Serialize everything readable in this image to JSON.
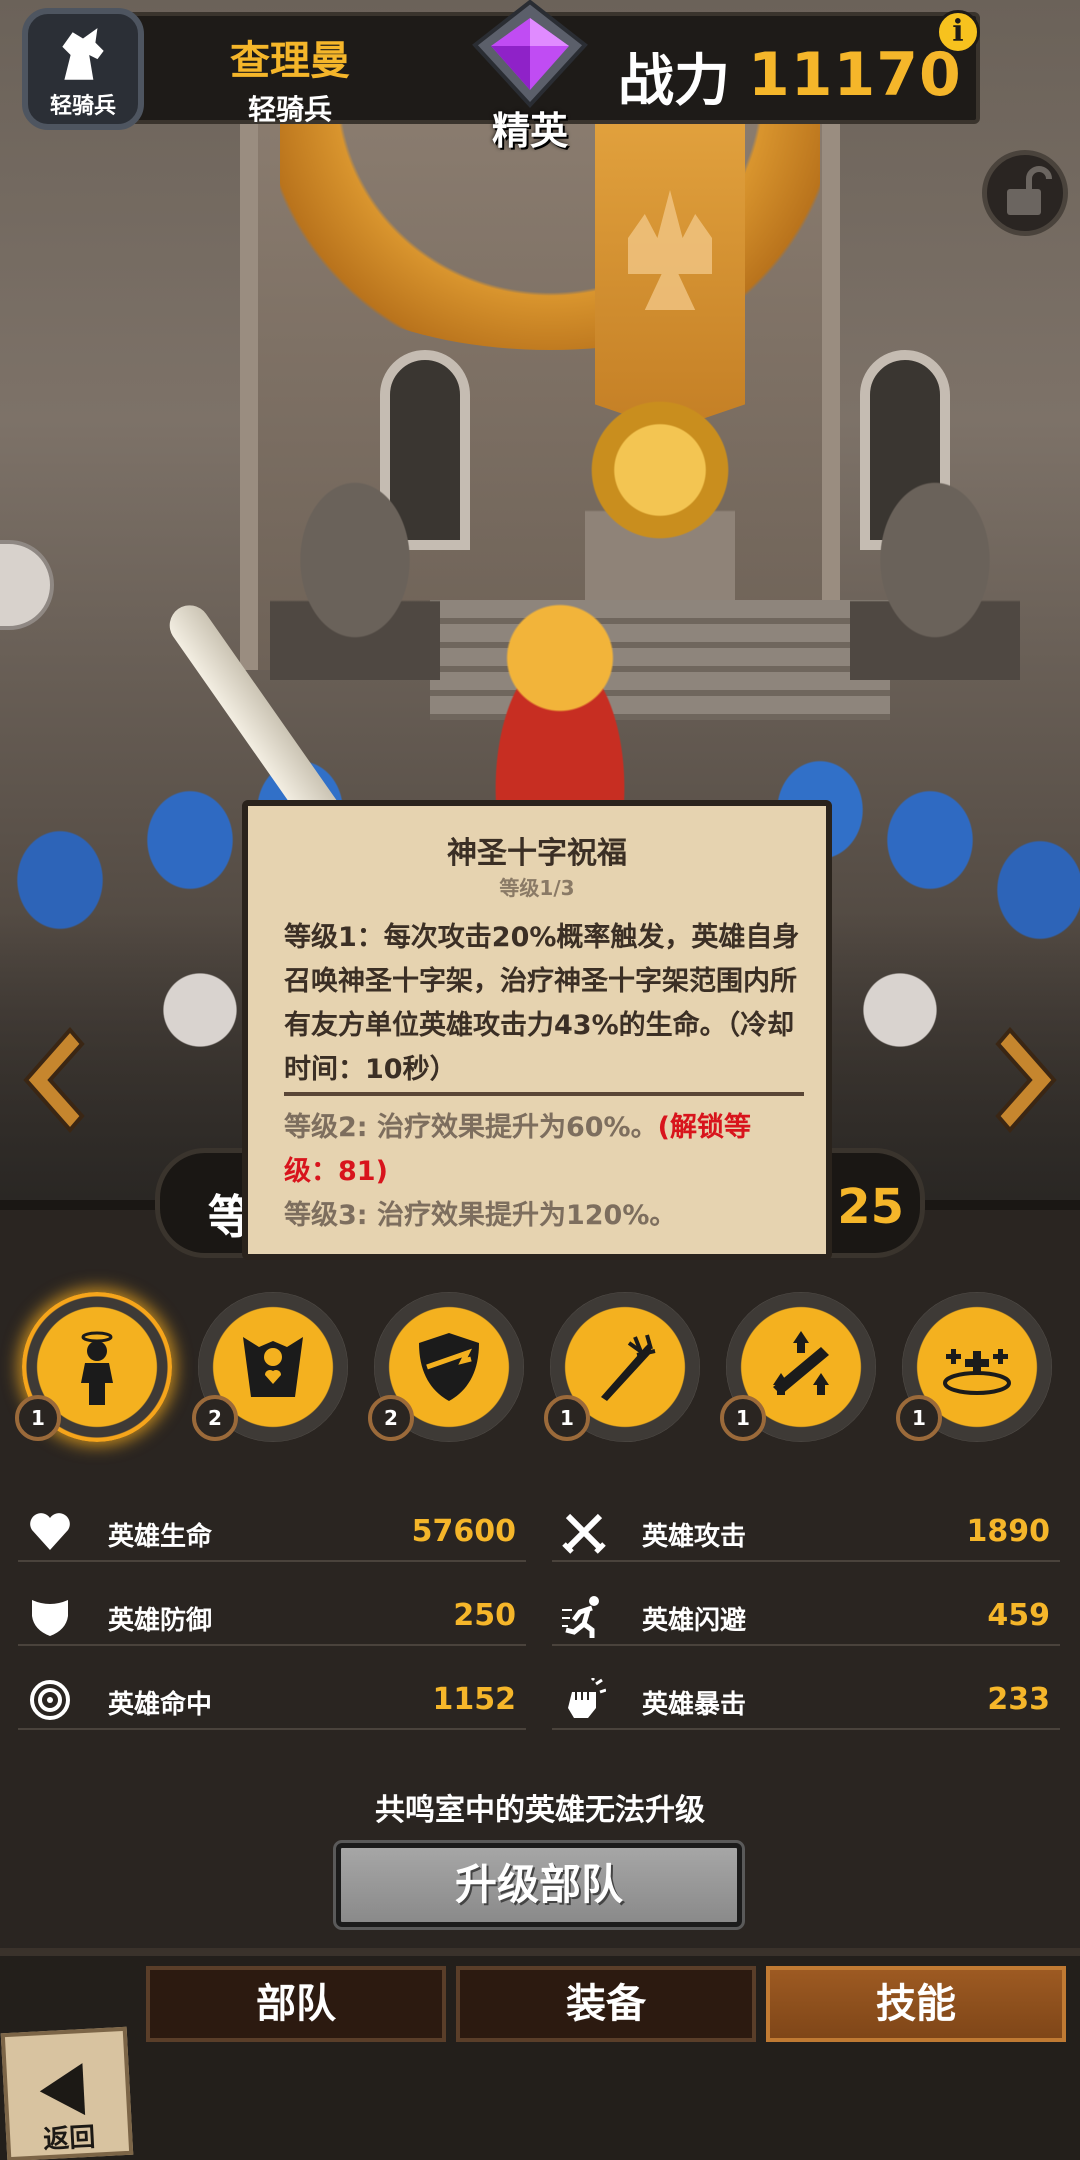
{
  "hud": {
    "class_badge_label": "轻骑兵",
    "hero_name": "查理曼",
    "hero_class": "轻骑兵",
    "rank_label": "精英",
    "power_label": "战力",
    "power_value": "11170",
    "info_icon": "i"
  },
  "level_strip": {
    "label_fragment": "等",
    "level_value": "25"
  },
  "tooltip": {
    "title": "神圣十字祝福",
    "level": "等级1/3",
    "current_effect": "等级1：每次攻击20%概率触发，英雄自身召唤神圣十字架，治疗神圣十字架范围内所有友方单位英雄攻击力43%的生命。（冷却时间：10秒）",
    "next_effect_2": "等级2: 治疗效果提升为60%。",
    "next_effect_2_lock": "(解锁等级：81)",
    "next_effect_3": "等级3: 治疗效果提升为120%。"
  },
  "skills": [
    {
      "icon": "holy-hero-icon",
      "level": "1",
      "selected": true
    },
    {
      "icon": "heart-guardian-icon",
      "level": "2",
      "selected": false
    },
    {
      "icon": "shield-break-icon",
      "level": "2",
      "selected": false
    },
    {
      "icon": "sword-strike-icon",
      "level": "1",
      "selected": false
    },
    {
      "icon": "attack-boost-icon",
      "level": "1",
      "selected": false
    },
    {
      "icon": "holy-crosses-icon",
      "level": "1",
      "selected": false
    }
  ],
  "stats": {
    "hp": {
      "label": "英雄生命",
      "value": "57600"
    },
    "atk": {
      "label": "英雄攻击",
      "value": "1890"
    },
    "def": {
      "label": "英雄防御",
      "value": "250"
    },
    "dodge": {
      "label": "英雄闪避",
      "value": "459"
    },
    "hit": {
      "label": "英雄命中",
      "value": "1152"
    },
    "crit": {
      "label": "英雄暴击",
      "value": "233"
    }
  },
  "notice": "共鸣室中的英雄无法升级",
  "upgrade_button": "升级部队",
  "tabs": {
    "troops": "部队",
    "equipment": "装备",
    "skills": "技能",
    "active": "skills"
  },
  "back_button": "返回",
  "colors": {
    "accent_gold": "#f5b62a",
    "panel_dark": "#2a2521",
    "tooltip_bg": "#e6d3b0",
    "lock_red": "#d8141c",
    "gem_purple": "#b23cf0"
  }
}
